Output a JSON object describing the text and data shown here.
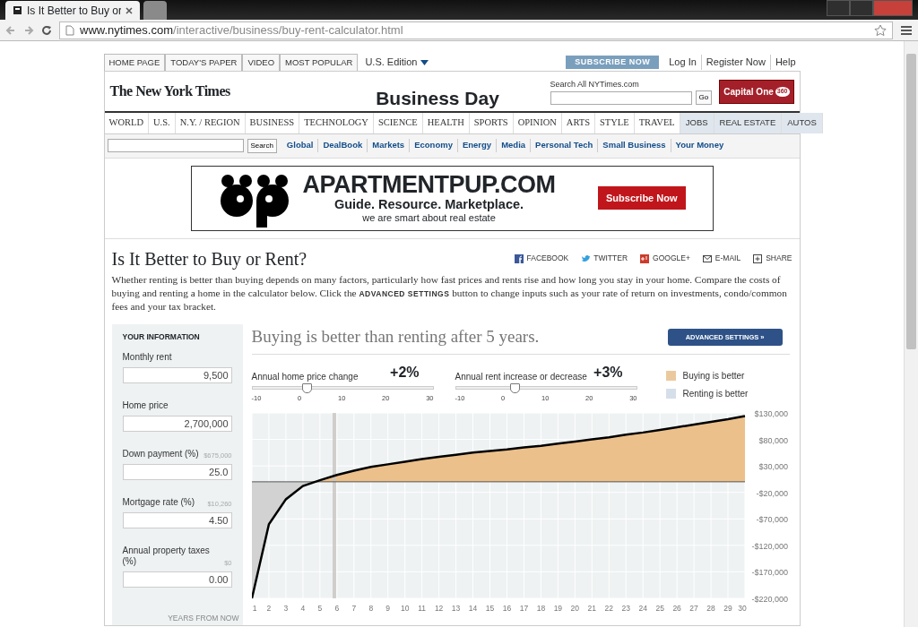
{
  "browser": {
    "tabs": [
      {
        "title": "Is It Better to Buy or",
        "selected": true
      },
      {
        "selected": false
      }
    ],
    "url_host": "www.nytimes.com",
    "url_path": "/interactive/business/buy-rent-calculator.html"
  },
  "top_links": [
    "HOME PAGE",
    "TODAY'S PAPER",
    "VIDEO",
    "MOST POPULAR"
  ],
  "edition": "U.S. Edition",
  "subscribe": "SUBSCRIBE NOW",
  "account_links": [
    "Log In",
    "Register Now",
    "Help"
  ],
  "masthead": {
    "logo": "The New York Times",
    "section": "Business Day",
    "search_label": "Search All NYTimes.com",
    "search_button": "Go",
    "sponsor": "Capital One",
    "sponsor_badge": "360"
  },
  "sections": [
    {
      "label": "WORLD",
      "kind": "section"
    },
    {
      "label": "U.S.",
      "kind": "section"
    },
    {
      "label": "N.Y. / REGION",
      "kind": "section"
    },
    {
      "label": "BUSINESS",
      "kind": "section"
    },
    {
      "label": "TECHNOLOGY",
      "kind": "section"
    },
    {
      "label": "SCIENCE",
      "kind": "section"
    },
    {
      "label": "HEALTH",
      "kind": "section"
    },
    {
      "label": "SPORTS",
      "kind": "section"
    },
    {
      "label": "OPINION",
      "kind": "section"
    },
    {
      "label": "ARTS",
      "kind": "section"
    },
    {
      "label": "STYLE",
      "kind": "section"
    },
    {
      "label": "TRAVEL",
      "kind": "section"
    },
    {
      "label": "JOBS",
      "kind": "classified"
    },
    {
      "label": "REAL ESTATE",
      "kind": "classified"
    },
    {
      "label": "AUTOS",
      "kind": "classified"
    }
  ],
  "subnav": {
    "search_button": "Search",
    "links": [
      "Global",
      "DealBook",
      "Markets",
      "Economy",
      "Energy",
      "Media",
      "Personal Tech",
      "Small Business",
      "Your Money"
    ]
  },
  "ad": {
    "brand": "APARTMENTPUP.COM",
    "tagline": "Guide. Resource. Marketplace.",
    "subline": "we are smart about real estate",
    "button": "Subscribe Now"
  },
  "article": {
    "title": "Is It Better to Buy or Rent?",
    "share": [
      {
        "label": "FACEBOOK",
        "kind": "facebook"
      },
      {
        "label": "TWITTER",
        "kind": "twitter"
      },
      {
        "label": "GOOGLE+",
        "kind": "google"
      },
      {
        "label": "E-MAIL",
        "kind": "email"
      },
      {
        "label": "SHARE",
        "kind": "share"
      }
    ],
    "intro": "Whether renting is better than buying depends on many factors, particularly how fast prices and rents rise and how long you stay in your home. Compare the costs of buying and renting a home in the calculator below. Click the **ADVANCED SETTINGS** button to change inputs such as your rate of return on investments, condo/common fees and your tax bracket."
  },
  "calculator": {
    "sidebar_title": "YOUR INFORMATION",
    "fields": [
      {
        "label": "Monthly rent",
        "value": "9,500"
      },
      {
        "label": "Home price",
        "value": "2,700,000"
      },
      {
        "label": "Down payment (%)",
        "note": "$675,000",
        "value": "25.0"
      },
      {
        "label": "Mortgage rate (%)",
        "note": "$10,260",
        "value": "4.50"
      },
      {
        "label": "Annual property taxes (%)",
        "note": "$0",
        "value": "0.00"
      }
    ],
    "headline": "Buying is better than renting after 5 years.",
    "advanced_button": "ADVANCED SETTINGS »",
    "sliders": [
      {
        "label": "Annual home price change",
        "reading": "+2%",
        "level": 0.3,
        "ticks": [
          "-10",
          "0",
          "10",
          "20",
          "30"
        ]
      },
      {
        "label": "Annual rent increase or decrease",
        "reading": "+3%",
        "level": 0.325,
        "ticks": [
          "-10",
          "0",
          "10",
          "20",
          "30"
        ]
      }
    ],
    "legend": [
      {
        "label": "Buying is better",
        "color": "#ebc99f"
      },
      {
        "label": "Renting is better",
        "color": "#d5dfea"
      }
    ],
    "chart_data": {
      "type": "line",
      "xlabel": "YEARS FROM NOW",
      "x": [
        1,
        2,
        3,
        4,
        5,
        6,
        7,
        8,
        9,
        10,
        11,
        12,
        13,
        14,
        15,
        16,
        17,
        18,
        19,
        20,
        21,
        22,
        23,
        24,
        25,
        26,
        27,
        28,
        29,
        30
      ],
      "series": [
        {
          "color": "#000000",
          "values": [
            -220000,
            -80000,
            -33000,
            -8000,
            3000,
            13000,
            21000,
            28000,
            33000,
            38000,
            43000,
            47000,
            51000,
            55000,
            58000,
            61000,
            65000,
            68000,
            72000,
            76000,
            80000,
            84000,
            89000,
            93000,
            98000,
            103000,
            108000,
            113000,
            118000,
            124000
          ]
        }
      ],
      "xlim": [
        1,
        30
      ],
      "ylim": [
        -220000,
        130000
      ],
      "xticks": [
        1,
        2,
        3,
        4,
        5,
        6,
        7,
        8,
        9,
        10,
        11,
        12,
        13,
        14,
        15,
        16,
        17,
        18,
        19,
        20,
        21,
        22,
        23,
        24,
        25,
        26,
        27,
        28,
        29,
        30
      ],
      "yticks": [
        {
          "value": 130000,
          "label": "$130,000"
        },
        {
          "value": 80000,
          "label": "$80,000"
        },
        {
          "value": 30000,
          "label": "$30,000"
        },
        {
          "value": -20000,
          "label": "-$20,000"
        },
        {
          "value": -70000,
          "label": "-$70,000"
        },
        {
          "value": -120000,
          "label": "-$120,000"
        },
        {
          "value": -170000,
          "label": "-$170,000"
        },
        {
          "value": -220000,
          "label": "-$220,000"
        }
      ],
      "grid": true
    }
  }
}
